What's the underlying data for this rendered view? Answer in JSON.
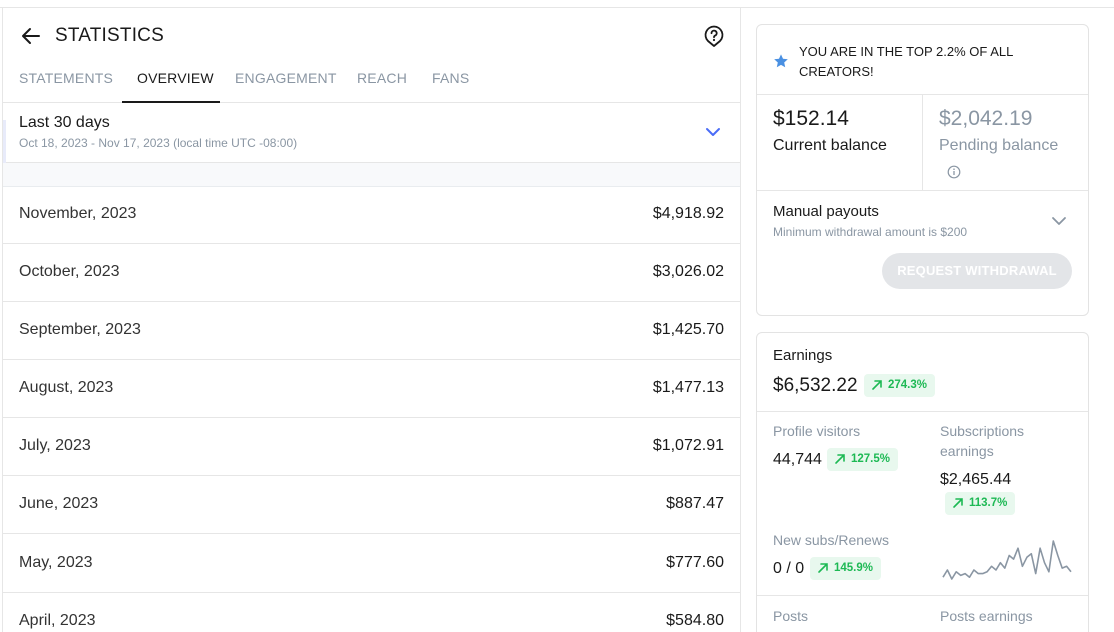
{
  "header": {
    "title": "STATISTICS",
    "back_icon": "arrow-left-icon",
    "help_icon": "question-circle-icon"
  },
  "tabs": [
    {
      "label": "STATEMENTS",
      "active": false
    },
    {
      "label": "OVERVIEW",
      "active": true
    },
    {
      "label": "ENGAGEMENT",
      "active": false
    },
    {
      "label": "REACH",
      "active": false
    },
    {
      "label": "FANS",
      "active": false
    }
  ],
  "period": {
    "title": "Last 30 days",
    "range": "Oct 18, 2023 - Nov 17, 2023 (local time UTC -08:00)"
  },
  "months": [
    {
      "label": "November, 2023",
      "value": "$4,918.92"
    },
    {
      "label": "October, 2023",
      "value": "$3,026.02"
    },
    {
      "label": "September, 2023",
      "value": "$1,425.70"
    },
    {
      "label": "August, 2023",
      "value": "$1,477.13"
    },
    {
      "label": "July, 2023",
      "value": "$1,072.91"
    },
    {
      "label": "June, 2023",
      "value": "$887.47"
    },
    {
      "label": "May, 2023",
      "value": "$777.60"
    },
    {
      "label": "April, 2023",
      "value": "$584.80"
    }
  ],
  "top_card": {
    "banner": "YOU ARE IN THE TOP 2.2% OF ALL CREATORS!",
    "current_balance": "$152.14",
    "current_label": "Current balance",
    "pending_balance": "$2,042.19",
    "pending_label": "Pending balance",
    "payout_title": "Manual payouts",
    "payout_sub": "Minimum withdrawal amount is $200",
    "withdraw_label": "REQUEST WITHDRAWAL"
  },
  "earnings": {
    "title": "Earnings",
    "amount": "$6,532.22",
    "change": "274.3%",
    "profile_visitors_label": "Profile visitors",
    "profile_visitors_value": "44,744",
    "profile_visitors_change": "127.5%",
    "subs_earnings_label": "Subscriptions earnings",
    "subs_earnings_value": "$2,465.44",
    "subs_earnings_change": "113.7%",
    "new_subs_label": "New subs/Renews",
    "new_subs_value": "0 / 0",
    "new_subs_change": "145.9%",
    "posts_label": "Posts",
    "posts_earnings_label": "Posts earnings"
  },
  "sparkline": [
    2,
    6,
    1,
    5,
    3,
    4,
    2,
    6,
    4,
    4,
    5,
    8,
    6,
    10,
    7,
    14,
    12,
    18,
    8,
    13,
    15,
    4,
    18,
    10,
    5,
    22,
    14,
    7,
    8,
    5
  ],
  "colors": {
    "accent_blue": "#4a90e2",
    "badge_green": "#1db954",
    "muted": "#8a96a3"
  }
}
